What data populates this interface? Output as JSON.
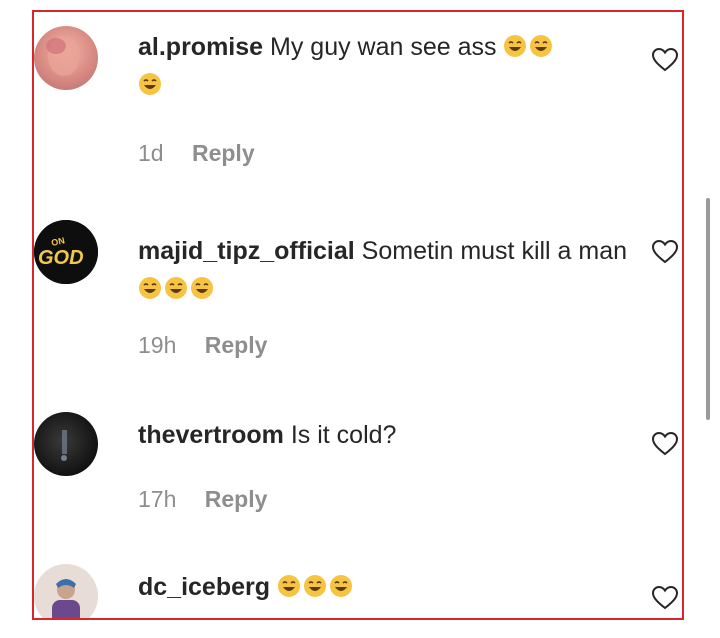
{
  "comments": [
    {
      "username": "al.promise",
      "text": "My guy wan see ass",
      "emoji": [
        "😂",
        "😂",
        "😂"
      ],
      "time": "1d",
      "reply_label": "Reply",
      "avatar_icon": "avatar-photo"
    },
    {
      "username": "majid_tipz_official",
      "text": "Sometin must kill a man",
      "emoji": [
        "😂",
        "😂",
        "😂"
      ],
      "time": "19h",
      "reply_label": "Reply",
      "avatar_icon": "avatar-on-god-logo",
      "avatar_text_top": "ON",
      "avatar_text_bottom": "GOD"
    },
    {
      "username": "thevertroom",
      "text": "Is it cold?",
      "emoji": [],
      "time": "17h",
      "reply_label": "Reply",
      "avatar_icon": "avatar-dark-photo"
    },
    {
      "username": "dc_iceberg",
      "text": "",
      "emoji": [
        "😂",
        "😂",
        "😂"
      ],
      "time": "",
      "reply_label": "",
      "avatar_icon": "avatar-photo"
    }
  ],
  "colors": {
    "frame_border": "#d9262b",
    "text": "#262626",
    "meta": "#8e8e8e"
  }
}
